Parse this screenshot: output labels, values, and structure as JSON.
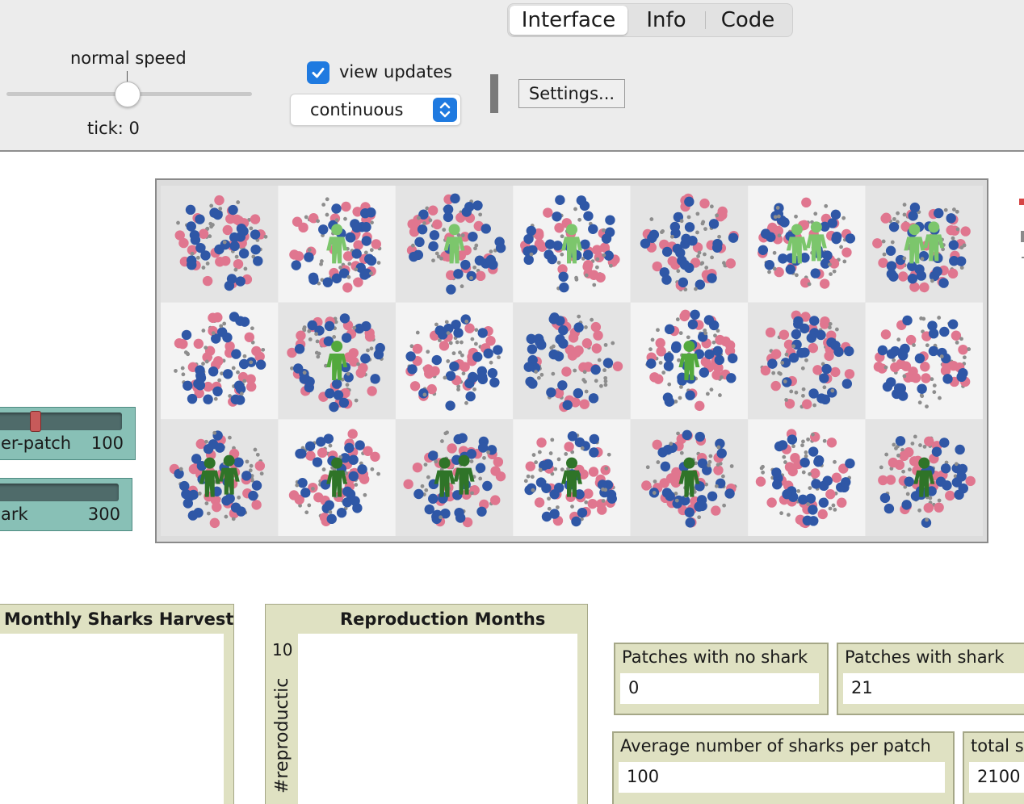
{
  "tabs": [
    {
      "label": "Interface",
      "active": true
    },
    {
      "label": "Info",
      "active": false
    },
    {
      "label": "Code",
      "active": false
    }
  ],
  "speed": {
    "label": "normal speed",
    "value": 0.5
  },
  "tick": {
    "label": "tick: 0"
  },
  "view_updates": {
    "label": "view updates",
    "checked": true
  },
  "update_mode": {
    "selected": "continuous"
  },
  "settings_button": {
    "label": "Settings..."
  },
  "sliders": [
    {
      "name": "er-patch",
      "value": "100"
    },
    {
      "name": "ark",
      "value": "300"
    }
  ],
  "plots": [
    {
      "title": "Monthly Sharks Harvest"
    },
    {
      "title": "Reproduction Months",
      "ytick_top": "10",
      "ylabel": "#reproductic"
    }
  ],
  "monitors": [
    {
      "label": "Patches with no shark",
      "value": "0"
    },
    {
      "label": "Patches with shark",
      "value": "21"
    },
    {
      "label": "Average number of sharks per patch",
      "value": "100"
    },
    {
      "label": "total s",
      "value": "2100"
    }
  ],
  "world": {
    "rows": 3,
    "cols": 7,
    "colors": {
      "pink": "#e0768f",
      "blue": "#2f57a6",
      "gray": "#8d8d8d",
      "light_green": "#7cc66c",
      "mid_green": "#53a93d",
      "dark_green": "#2f7428",
      "patch_light": "#f3f3f3",
      "patch_dark": "#e4e4e4"
    },
    "people_per_patch": [
      [
        0,
        1,
        1,
        1,
        0,
        2,
        2
      ],
      [
        0,
        1,
        0,
        0,
        1,
        0,
        0
      ],
      [
        2,
        1,
        2,
        1,
        1,
        0,
        1
      ]
    ]
  },
  "accent": "#1f7ae0"
}
